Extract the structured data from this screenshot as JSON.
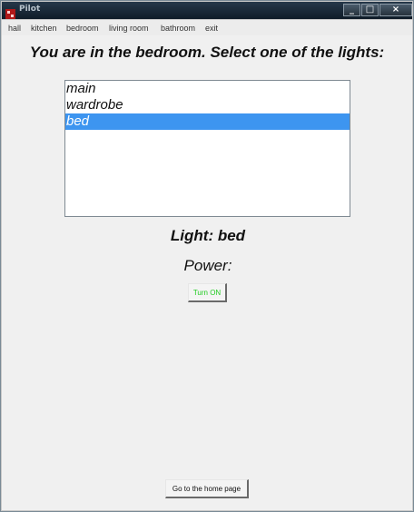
{
  "window": {
    "title": "Pilot",
    "controls": {
      "minimize": "_",
      "maximize": "□",
      "close": "×"
    }
  },
  "menu": {
    "items": [
      "hall",
      "kitchen",
      "bedroom",
      "living room",
      "bathroom",
      "exit"
    ]
  },
  "main": {
    "heading": "You are in the bedroom. Select one of the lights:",
    "lights": [
      {
        "label": "main",
        "selected": false
      },
      {
        "label": "wardrobe",
        "selected": false
      },
      {
        "label": "bed",
        "selected": true
      }
    ],
    "light_label": "Light: bed",
    "power_label": "Power:",
    "turn_on_button": "Turn ON",
    "home_button": "Go to the home page"
  },
  "colors": {
    "selection": "#3d95f0",
    "turn_on_text": "#22cc22",
    "title_bar": "#16222e"
  }
}
